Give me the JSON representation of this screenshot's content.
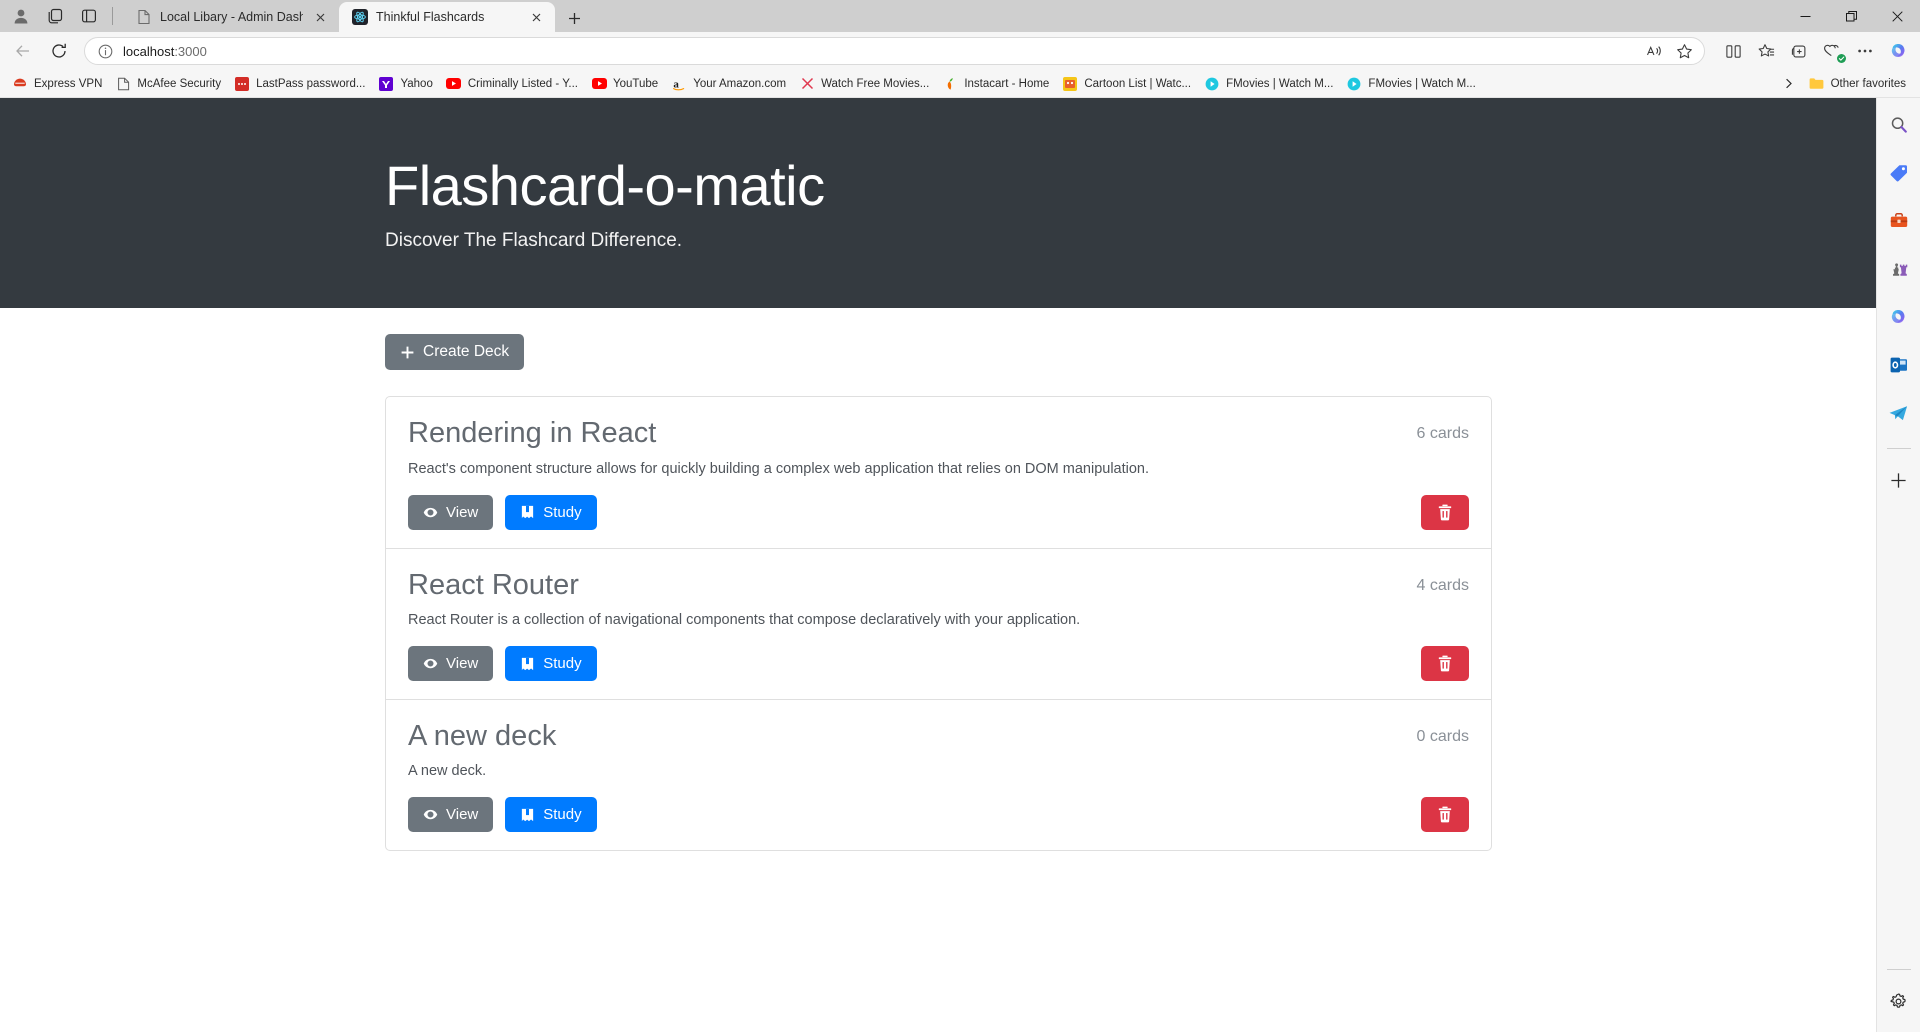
{
  "window": {
    "controls": {
      "minimize": "minimize-icon",
      "restore": "restore-icon",
      "close": "close-icon"
    }
  },
  "titlebar": {
    "profile_icon": "profile-avatar-icon",
    "workspaces_icon": "workspaces-icon",
    "tab_actions_icon": "tab-actions-icon",
    "new_tab_label": "+",
    "tabs": [
      {
        "title": "Local Libary - Admin Dashboard",
        "favicon": "document-icon",
        "active": false,
        "close": "×"
      },
      {
        "title": "Thinkful Flashcards",
        "favicon": "react-icon",
        "active": true,
        "close": "×"
      }
    ]
  },
  "navbar": {
    "back_icon": "back-arrow-icon",
    "refresh_icon": "refresh-icon",
    "info_icon": "site-info-icon",
    "url_host": "localhost",
    "url_port": ":3000",
    "url_full": "localhost:3000",
    "read_aloud_icon": "read-aloud-icon",
    "favorite_icon": "favorite-star-icon",
    "split_screen_icon": "split-screen-icon",
    "collections_icon": "collections-icon",
    "add_favorites_icon": "add-to-favorites-icon",
    "browser_essentials_icon": "browser-essentials-icon",
    "settings_more_icon": "settings-and-more-icon",
    "copilot_icon": "copilot-icon"
  },
  "bookmarks": {
    "items": [
      {
        "label": "Express VPN",
        "icon": "expressvpn-icon"
      },
      {
        "label": "McAfee Security",
        "icon": "mcafee-icon"
      },
      {
        "label": "LastPass password...",
        "icon": "lastpass-icon"
      },
      {
        "label": "Yahoo",
        "icon": "yahoo-icon"
      },
      {
        "label": "Criminally Listed - Y...",
        "icon": "youtube-icon"
      },
      {
        "label": "YouTube",
        "icon": "youtube-icon"
      },
      {
        "label": "Your Amazon.com",
        "icon": "amazon-icon"
      },
      {
        "label": "Watch Free Movies...",
        "icon": "x-icon"
      },
      {
        "label": "Instacart - Home",
        "icon": "instacart-icon"
      },
      {
        "label": "Cartoon List | Watc...",
        "icon": "cartoon-icon"
      },
      {
        "label": "FMovies | Watch M...",
        "icon": "fmovies-icon"
      },
      {
        "label": "FMovies | Watch M...",
        "icon": "fmovies-icon"
      }
    ],
    "overflow_icon": "chevron-right-icon",
    "other_favorites": "Other favorites",
    "other_favorites_icon": "folder-icon"
  },
  "page": {
    "header": {
      "title": "Flashcard-o-matic",
      "subtitle": "Discover The Flashcard Difference."
    },
    "create_deck": {
      "label": "Create Deck",
      "plus_icon": "plus-icon"
    },
    "labels": {
      "view": "View",
      "study": "Study",
      "view_icon": "eye-icon",
      "study_icon": "book-icon",
      "delete_icon": "trash-icon"
    },
    "decks": [
      {
        "title": "Rendering in React",
        "count": "6 cards",
        "description": "React's component structure allows for quickly building a complex web application that relies on DOM manipulation."
      },
      {
        "title": "React Router",
        "count": "4 cards",
        "description": "React Router is a collection of navigational components that compose declaratively with your application."
      },
      {
        "title": "A new deck",
        "count": "0 cards",
        "description": "A new deck."
      }
    ]
  },
  "edgebar": {
    "items": [
      {
        "icon": "search-icon"
      },
      {
        "icon": "shopping-tag-icon"
      },
      {
        "icon": "tools-briefcase-icon"
      },
      {
        "icon": "games-chess-icon"
      },
      {
        "icon": "copilot-icon"
      },
      {
        "icon": "outlook-icon"
      },
      {
        "icon": "telegram-send-icon"
      }
    ],
    "add_icon": "plus-icon",
    "settings_icon": "gear-icon"
  },
  "colors": {
    "jumbotron_bg": "#343a40",
    "primary": "#007bff",
    "secondary": "#6c757d",
    "danger": "#dc3545"
  }
}
